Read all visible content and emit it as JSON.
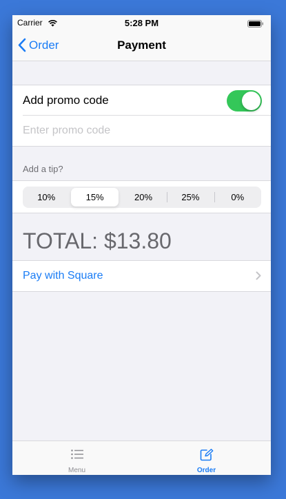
{
  "status": {
    "carrier": "Carrier",
    "time": "5:28 PM",
    "wifi_icon": "wifi-icon",
    "battery_icon": "battery-icon"
  },
  "nav": {
    "back_label": "Order",
    "title": "Payment"
  },
  "promo": {
    "label": "Add promo code",
    "toggle_on": true,
    "value": "",
    "placeholder": "Enter promo code"
  },
  "tip": {
    "header": "Add a tip?",
    "options": [
      "10%",
      "15%",
      "20%",
      "25%",
      "0%"
    ],
    "selected": "15%"
  },
  "total": "TOTAL: $13.80",
  "pay": {
    "label": "Pay with Square"
  },
  "tabs": [
    {
      "label": "Menu",
      "icon": "list-icon",
      "active": false
    },
    {
      "label": "Order",
      "icon": "compose-icon",
      "active": true
    }
  ],
  "colors": {
    "accent": "#1a7cf5",
    "toggle": "#34c759",
    "background": "#3b78d8"
  }
}
